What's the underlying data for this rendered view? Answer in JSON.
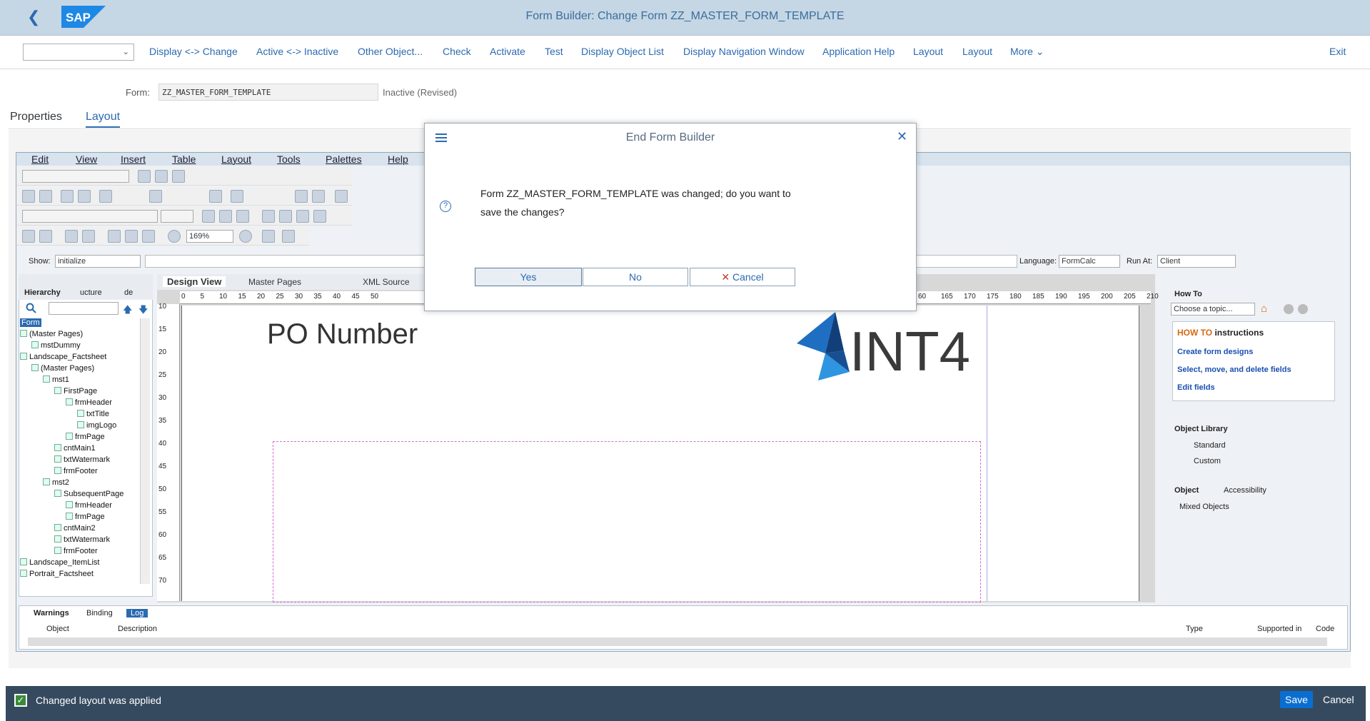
{
  "shell": {
    "title": "Form Builder: Change Form ZZ_MASTER_FORM_TEMPLATE",
    "logo": "SAP"
  },
  "toolbar": {
    "items": [
      "Display <-> Change",
      "Active <-> Inactive",
      "Other Object...",
      "Check",
      "Activate",
      "Test",
      "Display Object List",
      "Display Navigation Window",
      "Application Help",
      "Layout",
      "Layout",
      "More"
    ],
    "exit": "Exit"
  },
  "form": {
    "label": "Form:",
    "value": "ZZ_MASTER_FORM_TEMPLATE",
    "status": "Inactive (Revised)"
  },
  "tabs": {
    "properties": "Properties",
    "layout": "Layout"
  },
  "designer": {
    "menu": [
      "Edit",
      "View",
      "Insert",
      "Table",
      "Layout",
      "Tools",
      "Palettes",
      "Help"
    ],
    "zoom": "169%",
    "show_label": "Show:",
    "show_value": "initialize",
    "language_label": "Language:",
    "language_value": "FormCalc",
    "runat_label": "Run At:",
    "runat_value": "Client",
    "left_tabs": [
      "Hierarchy",
      "ucture",
      "de"
    ],
    "tree": [
      {
        "t": "Form",
        "lvl": 0
      },
      {
        "t": "(Master Pages)",
        "lvl": 0
      },
      {
        "t": "mstDummy",
        "lvl": 1
      },
      {
        "t": "Landscape_Factsheet",
        "lvl": 0
      },
      {
        "t": "(Master Pages)",
        "lvl": 1
      },
      {
        "t": "mst1",
        "lvl": 2
      },
      {
        "t": "FirstPage",
        "lvl": 3
      },
      {
        "t": "frmHeader",
        "lvl": 4
      },
      {
        "t": "txtTitle",
        "lvl": 5
      },
      {
        "t": "imgLogo",
        "lvl": 5
      },
      {
        "t": "frmPage",
        "lvl": 4
      },
      {
        "t": "cntMain1",
        "lvl": 3
      },
      {
        "t": "txtWatermark",
        "lvl": 3
      },
      {
        "t": "frmFooter",
        "lvl": 3
      },
      {
        "t": "mst2",
        "lvl": 2
      },
      {
        "t": "SubsequentPage",
        "lvl": 3
      },
      {
        "t": "frmHeader",
        "lvl": 4
      },
      {
        "t": "frmPage",
        "lvl": 4
      },
      {
        "t": "cntMain2",
        "lvl": 3
      },
      {
        "t": "txtWatermark",
        "lvl": 3
      },
      {
        "t": "frmFooter",
        "lvl": 3
      },
      {
        "t": "Landscape_ItemList",
        "lvl": 0
      },
      {
        "t": "Portrait_Factsheet",
        "lvl": 0
      }
    ],
    "center_tabs": [
      "Design View",
      "Master Pages",
      "XML Source"
    ],
    "ruler": [
      "0",
      "5",
      "10",
      "15",
      "20",
      "25",
      "30",
      "35",
      "40",
      "45",
      "50"
    ],
    "ruler_right": [
      "60",
      "165",
      "170",
      "175",
      "180",
      "185",
      "190",
      "195",
      "200",
      "205",
      "210"
    ],
    "vruler": [
      "10",
      "15",
      "20",
      "25",
      "30",
      "35",
      "40",
      "45",
      "50",
      "55",
      "60",
      "65",
      "70"
    ],
    "canvas": {
      "po": "PO Number",
      "brand": "INT4"
    },
    "howto": {
      "tab": "How To",
      "choose": "Choose a topic...",
      "head_a": "HOW TO",
      "head_b": "instructions",
      "links": [
        "Create form designs",
        "Select, move, and delete fields",
        "Edit fields"
      ]
    },
    "objlib": {
      "tab": "Object Library",
      "items": [
        "Standard",
        "Custom"
      ]
    },
    "object": {
      "tab": "Object",
      "tab2": "Accessibility",
      "content": "Mixed Objects"
    },
    "bottom": {
      "tabs": [
        "Warnings",
        "Binding",
        "Log"
      ],
      "cols": [
        "Object",
        "Description",
        "Type",
        "Supported in",
        "Code"
      ]
    }
  },
  "footer": {
    "message": "Changed layout was applied",
    "save": "Save",
    "cancel": "Cancel"
  },
  "dialog": {
    "title": "End Form Builder",
    "message": "Form ZZ_MASTER_FORM_TEMPLATE was changed; do you want to save the changes?",
    "yes": "Yes",
    "no": "No",
    "cancel": "Cancel"
  },
  "colors": {
    "shell": "#c5d6e4",
    "link": "#2a6ab0",
    "footer": "#354a5f",
    "save": "#0a6ed1",
    "brand_blue": "#1e6fc2"
  }
}
